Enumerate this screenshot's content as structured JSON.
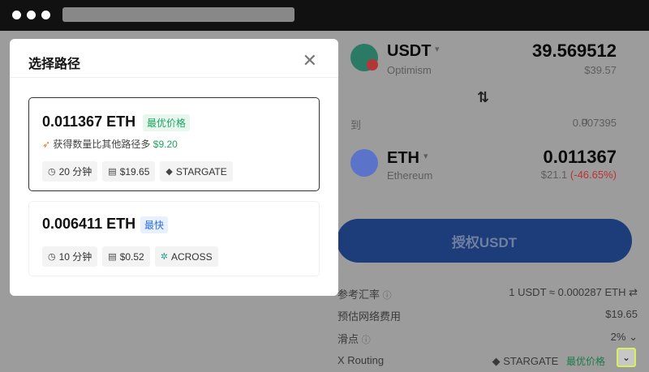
{
  "modal": {
    "title": "选择路径",
    "routes": [
      {
        "amount": "0.011367 ETH",
        "badge": "最优价格",
        "saving_prefix": "获得数量比其他路径多",
        "saving_amount": "$9.20",
        "time": "20 分钟",
        "fee": "$19.65",
        "bridge": "STARGATE"
      },
      {
        "amount": "0.006411 ETH",
        "badge": "最快",
        "time": "10 分钟",
        "fee": "$0.52",
        "bridge": "ACROSS"
      }
    ]
  },
  "swap": {
    "from": {
      "token": "USDT",
      "network": "Optimism",
      "amount": "39.569512",
      "usd": "$39.57"
    },
    "to_label": "到",
    "to_balance": "0.007395",
    "to": {
      "token": "ETH",
      "network": "Ethereum",
      "amount": "0.011367",
      "usd": "$21.1",
      "change": "(-46.65%)"
    },
    "approve_label": "授权USDT",
    "details": [
      {
        "label": "参考汇率",
        "value": "1 USDT ≈ 0.000287 ETH"
      },
      {
        "label": "预估网络费用",
        "value": "$19.65"
      },
      {
        "label": "滑点",
        "value": "2%"
      },
      {
        "label": "X Routing",
        "value": "STARGATE",
        "tag": "最优价格"
      }
    ]
  },
  "colors": {
    "best_green": "#1fa260",
    "fast_blue": "#2f6fd9",
    "approve_blue": "#1c3d7a",
    "highlight": "#d9f05a"
  }
}
